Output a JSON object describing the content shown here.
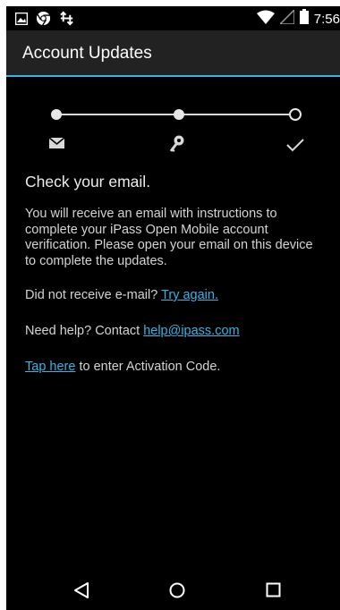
{
  "status_bar": {
    "time": "7:56",
    "left_icons": [
      "image-icon",
      "chrome-icon",
      "usb-transfer-icon"
    ],
    "right_icons": [
      "wifi-icon",
      "cell-signal-icon",
      "battery-icon"
    ]
  },
  "app_bar": {
    "title": "Account Updates"
  },
  "stepper": {
    "steps": [
      {
        "icon": "email-icon",
        "state": "complete"
      },
      {
        "icon": "key-icon",
        "state": "complete"
      },
      {
        "icon": "checkmark-icon",
        "state": "pending"
      }
    ]
  },
  "content": {
    "heading": "Check your email.",
    "instructions": "You will receive an email with instructions to complete your iPass Open Mobile account verification. Please open your email on this device to complete the updates.",
    "not_received_prefix": "Did not receive e-mail? ",
    "try_again_link": "Try again.",
    "help_prefix": "Need help? Contact ",
    "help_email_link": "help@ipass.com",
    "tap_here_link": "Tap here",
    "activation_suffix": " to enter Activation Code."
  },
  "nav_bar": {
    "buttons": [
      "back-icon",
      "home-icon",
      "recents-icon"
    ]
  },
  "colors": {
    "accent": "#33b5e5",
    "app_bar_bg": "#222222",
    "background": "#000000",
    "text": "#d4d4d4"
  }
}
